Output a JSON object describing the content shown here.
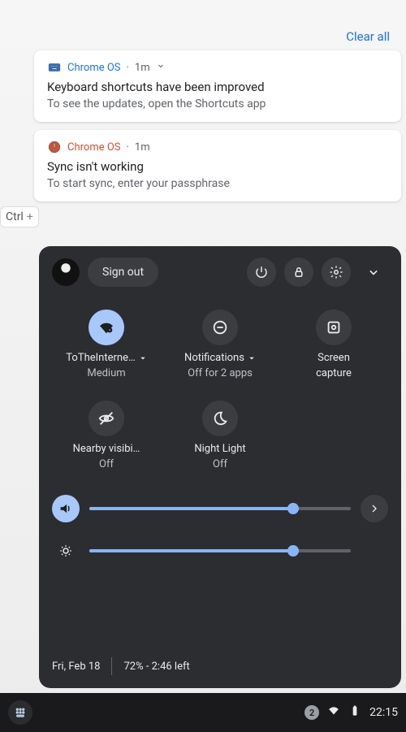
{
  "clear_all": "Clear all",
  "ctrl_key": "Ctrl",
  "notifications": [
    {
      "icon": "keyboard-icon",
      "source": "Chrome OS",
      "time": "1m",
      "expandable": true,
      "title": "Keyboard shortcuts have been improved",
      "body": "To see the updates, open the Shortcuts app",
      "warn": false
    },
    {
      "icon": "alert-icon",
      "source": "Chrome OS",
      "time": "1m",
      "expandable": false,
      "title": "Sync isn't working",
      "body": "To start sync, enter your passphrase",
      "warn": true
    }
  ],
  "qs": {
    "sign_out": "Sign out",
    "tiles": {
      "wifi": {
        "label": "ToTheInterne…",
        "sub": "Medium"
      },
      "notif": {
        "label": "Notifications",
        "sub": "Off for 2 apps"
      },
      "capture": {
        "label": "Screen capture",
        "sub_a": "Screen",
        "sub_b": "capture"
      },
      "nearby": {
        "label": "Nearby visibi…",
        "sub": "Off"
      },
      "night": {
        "label": "Night Light",
        "sub": "Off"
      }
    },
    "sliders": {
      "volume_pct": 78,
      "brightness_pct": 78
    },
    "date": "Fri, Feb 18",
    "battery": "72% - 2:46 left"
  },
  "shelf": {
    "badge": "2",
    "clock": "22:15"
  },
  "colors": {
    "accent": "#8ab4f8",
    "accent_bg": "#a8c7fa",
    "link": "#1a73e8"
  }
}
